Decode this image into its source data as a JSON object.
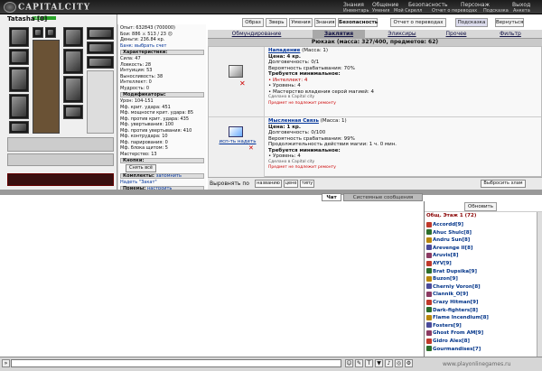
{
  "header": {
    "logo": "CAPITALCITY",
    "nav_top": [
      "Знания",
      "Общение",
      "Безопасность",
      "Персонаж",
      "Выход"
    ],
    "nav_bottom": [
      "Инвентарь",
      "Умения",
      "Мой Скрелл",
      "Отчет о переводах",
      "Подсказка",
      "Анкета"
    ]
  },
  "character": {
    "name": "Tatasha",
    "level": "[8]",
    "hp": "73/73",
    "stats_lines": [
      "Опыт: 632843 (700000)",
      "Бои: 886 ⚔ 513 / 23 ☹",
      "Деньги: 236.84 кр.",
      "Банк: выбрать счет"
    ],
    "characteristics_title": "Характеристики:",
    "characteristics": [
      "Сила: 47",
      "Ловкость: 28",
      "Интуиция: 53",
      "Выносливость: 38",
      "Интеллект: 0",
      "Мудрость: 0"
    ],
    "modifiers_title": "Модификаторы:",
    "modifiers": [
      "Урон: 104-151",
      "Мф. крит. удара: 451",
      "Мф. мощности крит. удара: 85",
      "Мф. против крит. удара: 435",
      "Мф. увертывания: 100",
      "Мф. против увертывания: 410",
      "Мф. контрудара: 10",
      "Мф. парирования: 0",
      "Мф. блока щитом: 5",
      "Мастерство: 13"
    ],
    "buttons_title": "Кнопки:",
    "undress_all": "Снять всё",
    "sets_title": "Комплекты:",
    "sets_link": "запомнить",
    "set_item": "Надеть \"Закат\"",
    "tricks_title": "Приемы:",
    "tricks_link": "настроить"
  },
  "top_buttons": [
    "Образ",
    "Зверь",
    "Умения",
    "Знания",
    "Безопасность",
    "Отчет о переводах",
    "Подсказка",
    "Вернуться"
  ],
  "tabs": [
    "Обмундирование",
    "Заклятия",
    "Эликсиры",
    "Прочее",
    "Фильтр"
  ],
  "active_tab": 1,
  "backpack": "Рюкзак (масса: 327/400, предметов: 62)",
  "items": [
    {
      "name": "Нападение",
      "mass": "(Масса: 1)",
      "price": "Цена: 4 кр.",
      "durability": "Долговечность: 0/1",
      "chance": "Вероятность срабатывания: 70%",
      "req_title": "Требуется минимальное:",
      "reqs": [
        "• Интеллект: 4",
        "• Уровень: 4",
        "• Мастерство владения серой магией: 4"
      ],
      "made": "Сделано в Capital city",
      "note": "Предмет не подлежит ремонту",
      "action": ""
    },
    {
      "name": "Мысленная Связь",
      "mass": "(Масса: 1)",
      "price": "Цена: 1 кр.",
      "durability": "Долговечность: 0/100",
      "chance": "Вероятность срабатывания: 99%",
      "duration": "Продолжительность действия магии: 1 ч. 0 мин.",
      "req_title": "Требуется минимальное:",
      "reqs": [
        "• Уровень: 4"
      ],
      "made": "Сделано в Capital city",
      "note": "Предмет не подлежит ремонту",
      "action": "исп-ть надеть"
    }
  ],
  "sortbar": {
    "label": "Выровнять по",
    "buttons": [
      "названию",
      "цене",
      "типу"
    ],
    "right": "Выбросить хлам"
  },
  "chat": {
    "tabs": [
      "Чат",
      "Системные сообщения"
    ]
  },
  "online": {
    "refresh": "Обновить",
    "title": "Общ. Этаж 1 (72)",
    "players": [
      "Accordd[9]",
      "Ahuc Shulc[8]",
      "Andru Sun[8]",
      "Arevenge II[8]",
      "Aruvis[8]",
      "AYV[9]",
      "Brat Dupsika[9]",
      "Buzon[9]",
      "Cherniy Voron[8]",
      "Clannik_O[9]",
      "Crazy Hitman[9]",
      "Dark-fighters[8]",
      "Flame Incendium[8]",
      "Fosters[9]",
      "Ghost From AM[9]",
      "Gidro Alex[8]",
      "Gourmandises[7]"
    ],
    "colors": [
      "#c0392b",
      "#2c6e2c",
      "#b8860b",
      "#4a4a9a",
      "#8b3a62"
    ]
  },
  "footer": {
    "watermark": "www.playonlinegames.ru"
  }
}
